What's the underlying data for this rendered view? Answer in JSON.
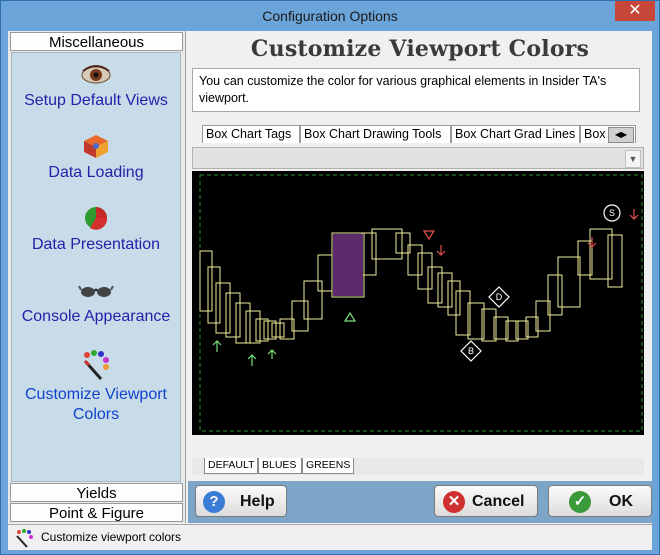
{
  "window": {
    "title": "Configuration Options",
    "close_glyph": "✕"
  },
  "sidebar": {
    "top_group": "Miscellaneous",
    "items": [
      {
        "label": "Setup Default Views",
        "icon": "eye-icon"
      },
      {
        "label": "Data Loading",
        "icon": "cube-icon"
      },
      {
        "label": "Data Presentation",
        "icon": "pie-icon"
      },
      {
        "label": "Console Appearance",
        "icon": "glasses-icon"
      },
      {
        "label": "Customize Viewport Colors",
        "icon": "palette-icon",
        "active": true
      }
    ],
    "bottom_groups": [
      "Yields",
      "Point & Figure"
    ]
  },
  "main": {
    "heading": "Customize Viewport Colors",
    "description": "You can customize the color for various graphical elements in Insider TA's viewport.",
    "tabs": [
      "Box Chart Tags",
      "Box Chart Drawing Tools",
      "Box Chart Grad Lines",
      "Box Cha"
    ],
    "schemes": [
      "DEFAULT",
      "BLUES",
      "GREENS"
    ],
    "chart_tags": {
      "b": "B",
      "d": "D",
      "s": "S"
    }
  },
  "buttons": {
    "help": "Help",
    "cancel": "Cancel",
    "ok": "OK"
  },
  "status": {
    "text": "Customize viewport colors"
  },
  "colors": {
    "box_stroke": "#f2ee9a",
    "box_fill": "#5d2a6b",
    "grid": "#2e8b2e",
    "up_arrow": "#7be07b",
    "down_arrow": "#e05050"
  }
}
